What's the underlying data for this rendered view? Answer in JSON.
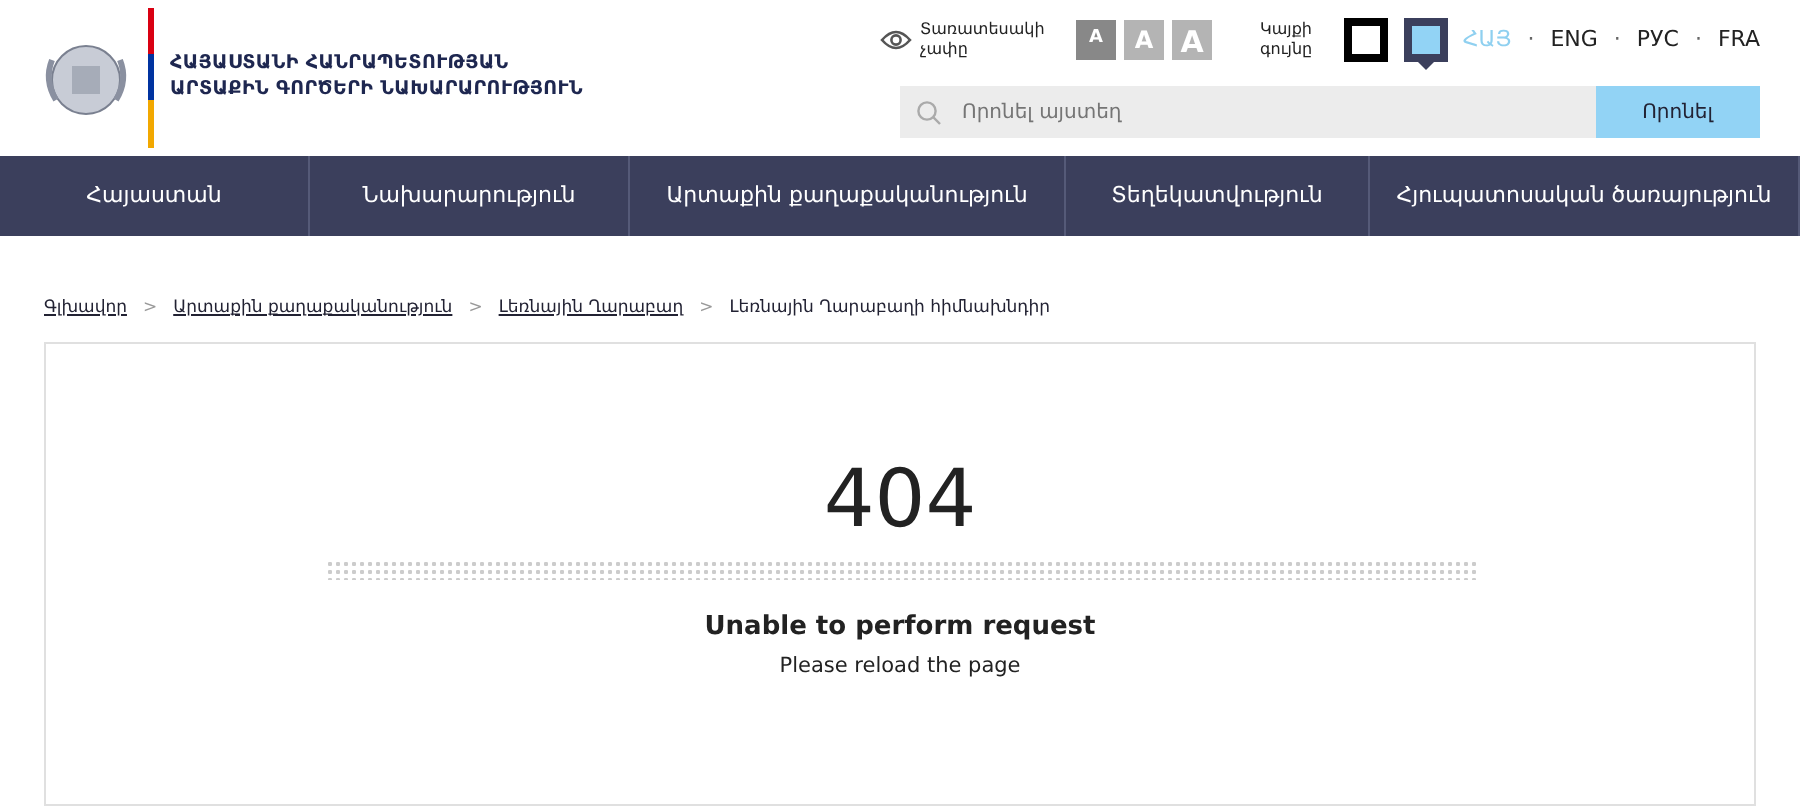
{
  "logo": {
    "lines": [
      "ՀԱՅԱՍՏԱՆԻ ՀԱՆՐԱՊԵՏՈՒԹՅԱՆ",
      "ԱՐՏԱՔԻՆ ԳՈՐԾԵՐԻ ՆԱԽԱՐԱՐՈՒԹՅՈՒՆ"
    ]
  },
  "font_size": {
    "label": "Տառատեսակի չափը",
    "options": [
      {
        "label": "A",
        "selected": true
      },
      {
        "label": "A",
        "selected": false
      },
      {
        "label": "A",
        "selected": false
      }
    ]
  },
  "site_color": {
    "label": "Կայքի գույնը",
    "options": [
      {
        "kind": "contrast",
        "selected": false
      },
      {
        "kind": "default",
        "selected": true
      }
    ]
  },
  "languages": [
    {
      "label": "ՀԱՅ",
      "selected": true
    },
    {
      "separator": "·",
      "label": "ENG",
      "selected": false
    },
    {
      "separator": "·",
      "label": "РУС",
      "selected": false
    },
    {
      "separator": "·",
      "label": "FRA",
      "selected": false
    }
  ],
  "search": {
    "placeholder": "Որոնել այստեղ",
    "button": "Որոնել"
  },
  "nav": [
    "Հայաստան",
    "Նախարարություն",
    "Արտաքին քաղաքականություն",
    "Տեղեկատվություն",
    "Հյուպատոսական ծառայություն"
  ],
  "breadcrumb": [
    {
      "label": "Գլխավոր",
      "link": true
    },
    {
      "separator": ">",
      "label": "Արտաքին քաղաքականություն",
      "link": true
    },
    {
      "separator": ">",
      "label": "Լեռնային Ղարաբաղ",
      "link": true
    },
    {
      "separator": ">",
      "label": "Լեռնային Ղարաբաղի հիմնախնդիր",
      "link": false
    }
  ],
  "error": {
    "code": "404",
    "title": "Unable to perform request",
    "message": "Please reload the page"
  }
}
